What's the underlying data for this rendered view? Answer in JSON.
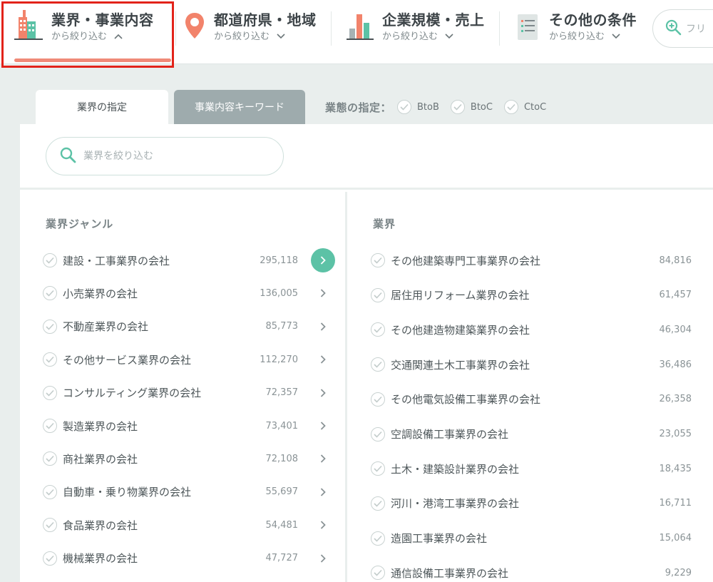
{
  "filters": [
    {
      "title": "業界・事業内容",
      "sub": "から絞り込む",
      "chevron": "up",
      "icon": "building-icon"
    },
    {
      "title": "都道府県・地域",
      "sub": "から絞り込む",
      "chevron": "down",
      "icon": "map-pin-icon"
    },
    {
      "title": "企業規模・売上",
      "sub": "から絞り込む",
      "chevron": "down",
      "icon": "bar-chart-icon"
    },
    {
      "title": "その他の条件",
      "sub": "から絞り込む",
      "chevron": "down",
      "icon": "document-list-icon"
    }
  ],
  "free_search": {
    "placeholder": "フリ"
  },
  "tabs": {
    "industry": "業界の指定",
    "keyword": "事業内容キーワード"
  },
  "business_type": {
    "label": "業態の指定：",
    "options": [
      "BtoB",
      "BtoC",
      "CtoC"
    ]
  },
  "search": {
    "placeholder": "業界を絞り込む"
  },
  "genres": {
    "header": "業界ジャンル",
    "items": [
      {
        "name": "建設・工事業界の会社",
        "count": "295,118",
        "active": true
      },
      {
        "name": "小売業界の会社",
        "count": "136,005"
      },
      {
        "name": "不動産業界の会社",
        "count": "85,773"
      },
      {
        "name": "その他サービス業界の会社",
        "count": "112,270"
      },
      {
        "name": "コンサルティング業界の会社",
        "count": "72,357"
      },
      {
        "name": "製造業界の会社",
        "count": "73,401"
      },
      {
        "name": "商社業界の会社",
        "count": "72,108"
      },
      {
        "name": "自動車・乗り物業界の会社",
        "count": "55,697"
      },
      {
        "name": "食品業界の会社",
        "count": "54,481"
      },
      {
        "name": "機械業界の会社",
        "count": "47,727"
      }
    ]
  },
  "industries": {
    "header": "業界",
    "items": [
      {
        "name": "その他建築専門工事業界の会社",
        "count": "84,816"
      },
      {
        "name": "居住用リフォーム業界の会社",
        "count": "61,457"
      },
      {
        "name": "その他建造物建築業界の会社",
        "count": "46,304"
      },
      {
        "name": "交通関連土木工事業界の会社",
        "count": "36,486"
      },
      {
        "name": "その他電気設備工事業界の会社",
        "count": "26,358"
      },
      {
        "name": "空調設備工事業界の会社",
        "count": "23,055"
      },
      {
        "name": "土木・建築設計業界の会社",
        "count": "18,435"
      },
      {
        "name": "河川・港湾工事業界の会社",
        "count": "16,711"
      },
      {
        "name": "造園工事業界の会社",
        "count": "15,064"
      },
      {
        "name": "通信設備工事業界の会社",
        "count": "9,229"
      }
    ]
  },
  "colors": {
    "accent": "#5cc2a6",
    "highlight": "#e2231a",
    "underline": "#f08a78"
  }
}
